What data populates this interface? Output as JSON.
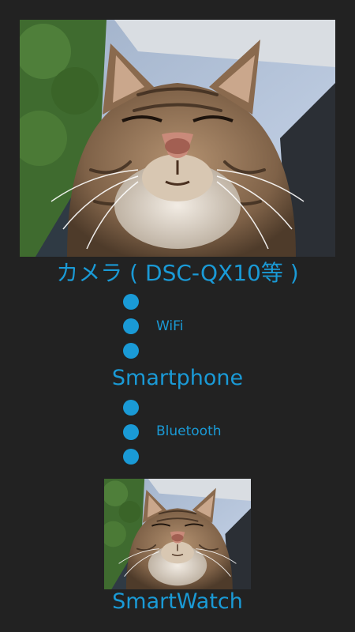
{
  "colors": {
    "background": "#222222",
    "accent": "#1a9ad6"
  },
  "flow": {
    "camera_label": "カメラ ( DSC-QX10等 )",
    "wifi_label": "WiFi",
    "smartphone_label": "Smartphone",
    "bluetooth_label": "Bluetooth",
    "smartwatch_label": "SmartWatch"
  }
}
